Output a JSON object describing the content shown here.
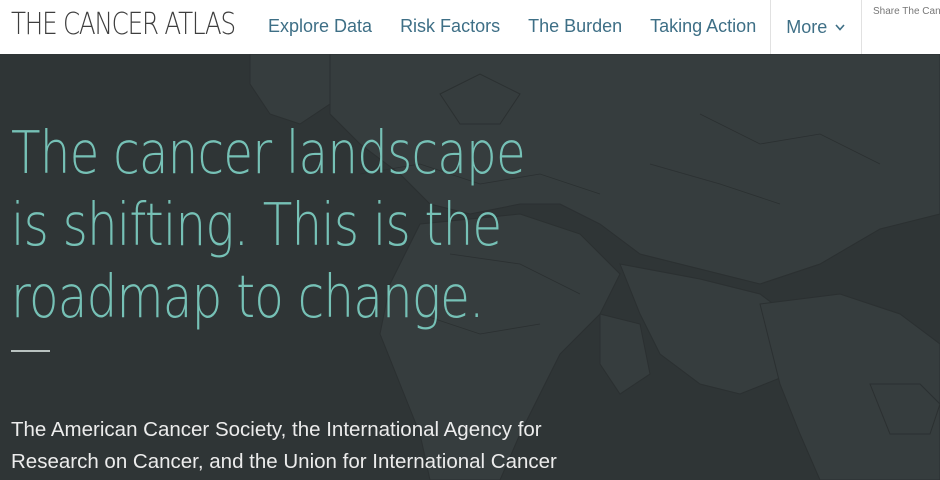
{
  "header": {
    "logo": "THE CANCER ATLAS",
    "nav": [
      {
        "label": "Explore Data"
      },
      {
        "label": "Risk Factors"
      },
      {
        "label": "The Burden"
      },
      {
        "label": "Taking Action"
      }
    ],
    "more_label": "More",
    "share_text": "Share The Canc"
  },
  "hero": {
    "headline": "The cancer landscape is shifting. This is the roadmap to change.",
    "intro": "The American Cancer Society, the International Agency for Research on Cancer, and the Union for International Cancer"
  },
  "colors": {
    "hero_bg": "#2f3536",
    "headline": "#76c1b6",
    "nav_link": "#3e6f86"
  }
}
